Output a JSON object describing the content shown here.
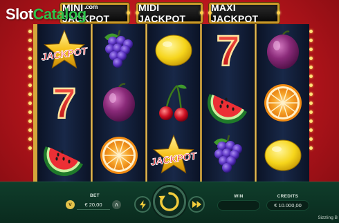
{
  "watermark": {
    "part1": "Slot",
    "part2": "Catalog",
    "com": ".com"
  },
  "jackpots": [
    {
      "label": "MINI JACKPOT"
    },
    {
      "label": "MIDI JACKPOT"
    },
    {
      "label": "MAXI JACKPOT"
    }
  ],
  "reels": [
    [
      "jackpot-star",
      "seven",
      "watermelon"
    ],
    [
      "grapes",
      "plum",
      "orange"
    ],
    [
      "lemon",
      "cherries",
      "jackpot-star"
    ],
    [
      "seven",
      "watermelon",
      "grapes"
    ],
    [
      "plum",
      "orange",
      "lemon"
    ]
  ],
  "symbol_text": {
    "jackpot": "JACKPOT",
    "seven": "7"
  },
  "controls": {
    "bet_label": "BET",
    "bet_value": "€ 20,00",
    "bet_minus_icon": "˅",
    "bet_plus_icon": "˄",
    "win_label": "WIN",
    "win_value": "",
    "credits_label": "CREDITS",
    "credits_value": "€ 10.000,00",
    "turbo_icon": "⚡",
    "autoplay_icon": "⏩"
  },
  "game_name": "Sizzling B",
  "colors": {
    "background_red": "#c81c22",
    "reel_frame_gold": "#d6a53a",
    "control_bar_green": "#0f3d2b",
    "spin_arrow_yellow": "#f2cc3c"
  }
}
